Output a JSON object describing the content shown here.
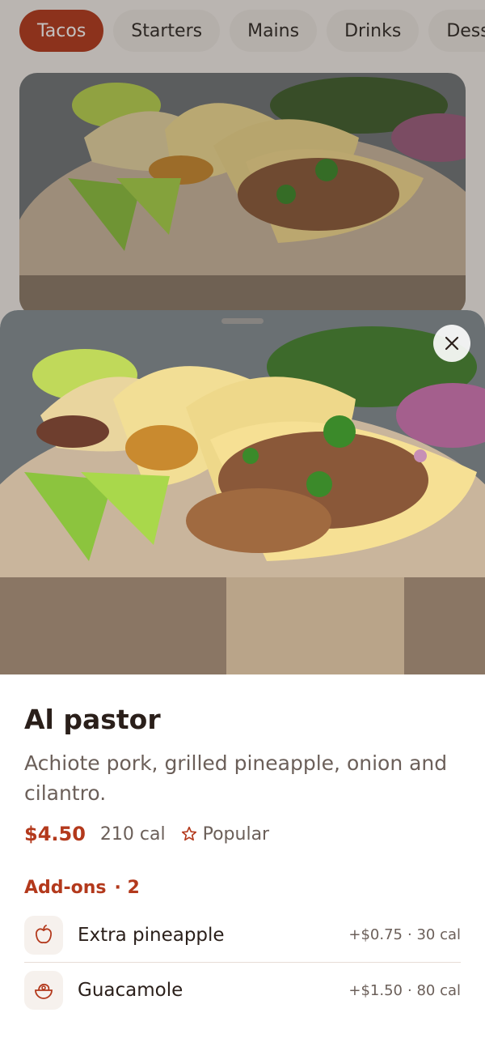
{
  "category_tabs": [
    "Tacos",
    "Starters",
    "Mains",
    "Drinks",
    "Desserts"
  ],
  "selected_tab": "Tacos",
  "item": {
    "title": "Al pastor",
    "description": "Achiote pork, grilled pineapple, onion and cilantro.",
    "price": "$4.50",
    "calories": "210 cal",
    "badge": "Popular",
    "badge_icon": "star-outline-icon"
  },
  "addons": {
    "label": "Add-ons",
    "count": "· 2",
    "items": [
      {
        "name": "Extra pineapple",
        "price": "+$0.75",
        "calories": "· 30 cal",
        "icon": "fruit-icon"
      },
      {
        "name": "Guacamole",
        "price": "+$1.50",
        "calories": "· 80 cal",
        "icon": "avocado-bowl-icon"
      }
    ]
  },
  "colors": {
    "accent": "#b3391c",
    "text": "#2a1f1a",
    "muted": "#6b5f59"
  },
  "close_icon": "close-icon"
}
